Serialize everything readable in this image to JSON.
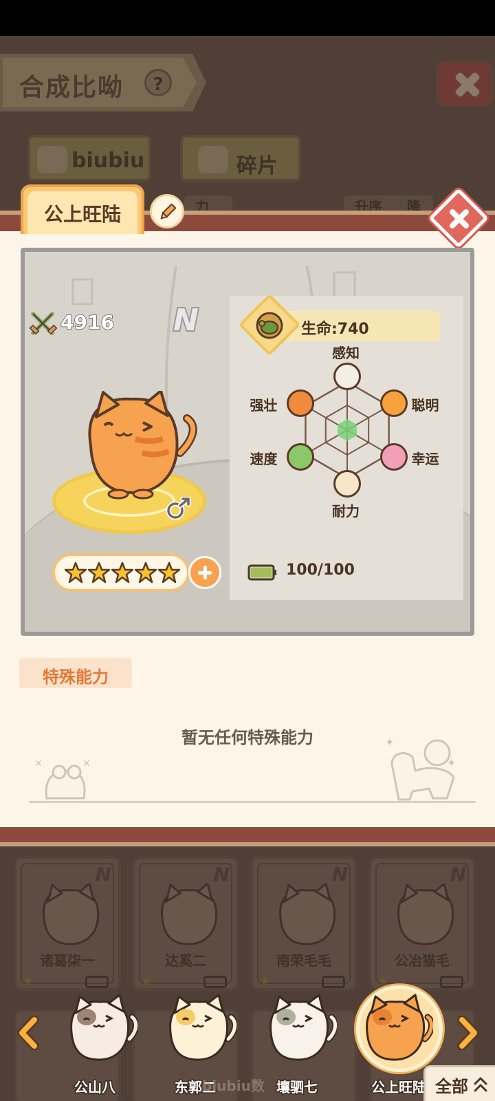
{
  "background_screen": {
    "title": "合成比呦",
    "help_symbol": "?",
    "tabs": [
      {
        "label": "biubiu"
      },
      {
        "label": "碎片"
      }
    ],
    "sort_partial": [
      "升序",
      "降"
    ],
    "filter_partial": "力"
  },
  "modal": {
    "cat_name": "公上旺陆",
    "power": "4916",
    "rarity": "N",
    "gender_symbol": "♂",
    "stars": 5,
    "stats": {
      "hp_label": "生命:740",
      "attributes": [
        {
          "label": "感知",
          "icon": "eagle-icon",
          "color": "#f2efe4"
        },
        {
          "label": "聪明",
          "icon": "monkey-icon",
          "color": "#f7a23c"
        },
        {
          "label": "幸运",
          "icon": "horse-icon",
          "color": "#f2a0b8"
        },
        {
          "label": "耐力",
          "icon": "ox-icon",
          "color": "#f7e6c8"
        },
        {
          "label": "速度",
          "icon": "cheetah-icon",
          "color": "#8cc86a"
        },
        {
          "label": "强壮",
          "icon": "bear-icon",
          "color": "#f08a3c"
        }
      ],
      "stamina": "100/100",
      "stamina_fraction": 1.0
    },
    "special_ability_title": "特殊能力",
    "special_ability_empty": "暂无任何特殊能力"
  },
  "collection_grid": [
    {
      "name": "诸葛柒一",
      "rarity": "N"
    },
    {
      "name": "达奚二",
      "rarity": "N"
    },
    {
      "name": "南荣毛毛",
      "rarity": "N"
    },
    {
      "name": "公冶猫毛",
      "rarity": "N"
    }
  ],
  "carousel": {
    "items": [
      {
        "name": "公山八"
      },
      {
        "name": "东郭二"
      },
      {
        "name": "壤驷七"
      },
      {
        "name": "公上旺陆",
        "selected": true
      }
    ],
    "left_arrow": "chevron-left-icon",
    "right_arrow": "chevron-right-icon"
  },
  "watermark": "biubiu数",
  "all_button": {
    "label": "全部",
    "icon": "double-chevron-up-icon"
  },
  "colors": {
    "accent_orange": "#f7a24e",
    "modal_stripe": "#8c4a3c",
    "panel_cream": "#fdf6e8"
  }
}
